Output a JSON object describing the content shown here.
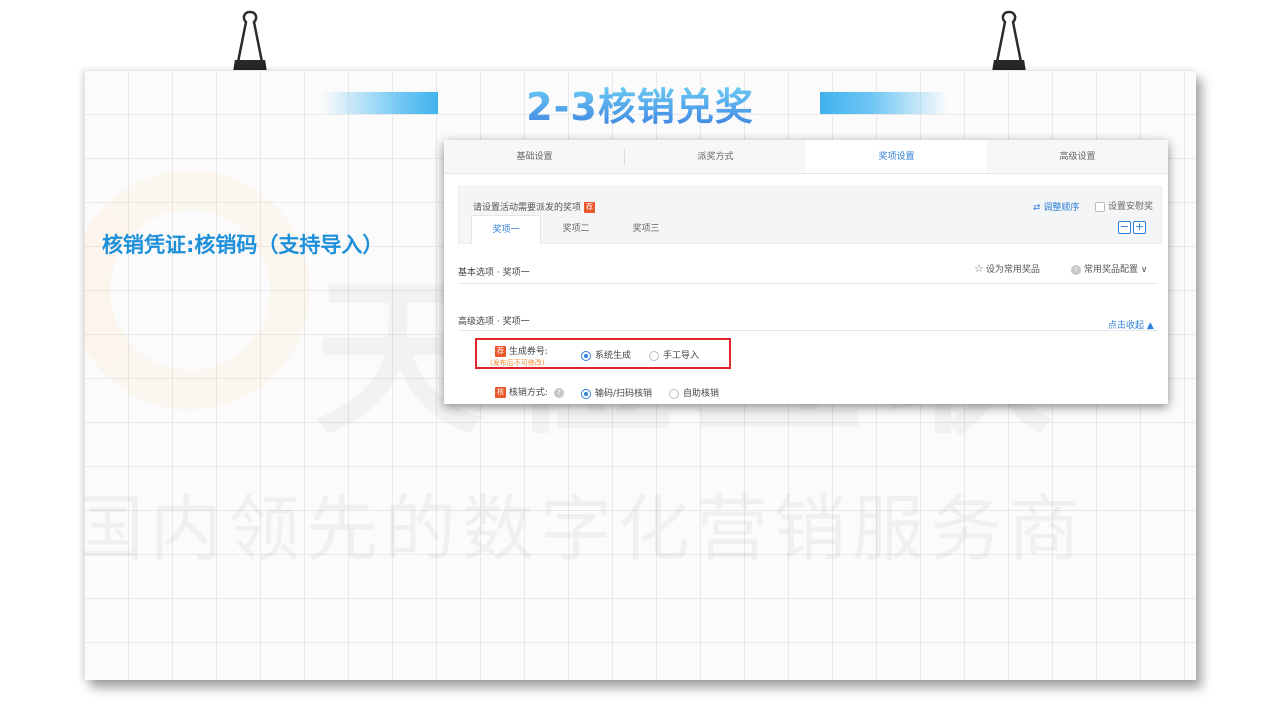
{
  "slide": {
    "title": "2-3核销兑奖",
    "caption": "核销凭证:核销码（支持导入）",
    "watermark_brand": "天橙互联",
    "watermark_slogan": "国内领先的数字化营销服务商"
  },
  "colors": {
    "accent": "#2e7fd9",
    "title_gradient_top": "#6fd0f6",
    "title_gradient_bottom": "#3b7fe0",
    "highlight_box": "#e0262d",
    "badge": "#e9572b",
    "note_orange": "#f08a32"
  },
  "screen": {
    "top_tabs": [
      {
        "label": "基础设置",
        "active": false
      },
      {
        "label": "派奖方式",
        "active": false
      },
      {
        "label": "奖项设置",
        "active": true
      },
      {
        "label": "高级设置",
        "active": false
      }
    ],
    "prize_hint": "请设置活动需要派发的奖项",
    "badge_label": "荐",
    "reorder_label": "⇄ 调整顺序",
    "consolation_label": "设置安慰奖",
    "prize_tabs": [
      {
        "label": "奖项一",
        "active": true
      },
      {
        "label": "奖项二",
        "active": false
      },
      {
        "label": "奖项三",
        "active": false
      }
    ],
    "minus_label": "−",
    "plus_label": "+",
    "basic_section": "基本选项 · 奖项一",
    "set_favorite": "设为常用奖品",
    "favorite_config": "常用奖品配置 ∨",
    "advanced_section": "高级选项 · 奖项一",
    "collapse_label": "点击收起 ▲",
    "generate_code_label": "生成券号:",
    "generate_code_note": "(发布后不可修改)",
    "option_system": "系统生成",
    "option_manual": "手工导入",
    "verify_label": "核销方式:",
    "verify_badge": "核",
    "option_scan": "输码/扫码核销",
    "option_self": "自助核销"
  },
  "icons": {
    "clip": "binder-clip-icon",
    "star": "star-icon",
    "question": "question-icon",
    "swap": "swap-icon"
  }
}
